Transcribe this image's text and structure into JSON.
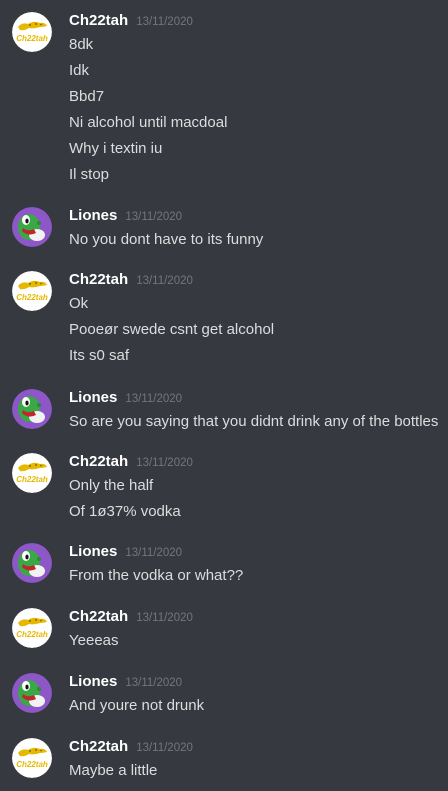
{
  "messages": [
    {
      "author": "Ch22tah",
      "avatar": "cheetah-avatar",
      "timestamp": "13/11/2020",
      "lines": [
        "8dk",
        "Idk",
        "Bbd7",
        "Ni alcohol until macdoal",
        "Why i textin iu",
        "Il stop"
      ]
    },
    {
      "author": "Liones",
      "avatar": "yoshi-avatar",
      "timestamp": "13/11/2020",
      "lines": [
        "No you dont have to its funny"
      ]
    },
    {
      "author": "Ch22tah",
      "avatar": "cheetah-avatar",
      "timestamp": "13/11/2020",
      "lines": [
        "Ok",
        "Pooeør swede csnt get alcohol",
        "Its s0 saf"
      ]
    },
    {
      "author": "Liones",
      "avatar": "yoshi-avatar",
      "timestamp": "13/11/2020",
      "lines": [
        "So are you saying that you didnt drink any of the bottles"
      ]
    },
    {
      "author": "Ch22tah",
      "avatar": "cheetah-avatar",
      "timestamp": "13/11/2020",
      "lines": [
        "Only the half",
        "Of 1ø37% vodka"
      ]
    },
    {
      "author": "Liones",
      "avatar": "yoshi-avatar",
      "timestamp": "13/11/2020",
      "lines": [
        "From the vodka or what??"
      ]
    },
    {
      "author": "Ch22tah",
      "avatar": "cheetah-avatar",
      "timestamp": "13/11/2020",
      "lines": [
        "Yeeeas"
      ]
    },
    {
      "author": "Liones",
      "avatar": "yoshi-avatar",
      "timestamp": "13/11/2020",
      "lines": [
        "And youre not drunk"
      ]
    },
    {
      "author": "Ch22tah",
      "avatar": "cheetah-avatar",
      "timestamp": "13/11/2020",
      "lines": [
        "Maybe a little"
      ]
    }
  ],
  "colors": {
    "background": "#36393f",
    "username": "#ffffff",
    "timestamp": "#72767d",
    "message_text": "#dcddde",
    "yoshi_avatar_bg": "#8e57c8",
    "cheetah_accent": "#e6b800"
  }
}
